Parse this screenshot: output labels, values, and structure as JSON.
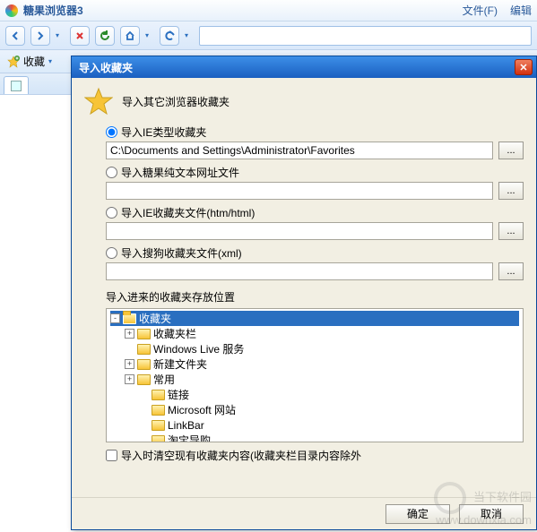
{
  "window": {
    "title": "糖果浏览器3"
  },
  "menu": {
    "file": "文件(F)",
    "edit": "编辑"
  },
  "favbar": {
    "label": "收藏"
  },
  "dialog": {
    "title": "导入收藏夹",
    "intro": "导入其它浏览器收藏夹",
    "opts": {
      "ie": {
        "label": "导入IE类型收藏夹",
        "path": "C:\\Documents and Settings\\Administrator\\Favorites"
      },
      "txt": {
        "label": "导入糖果纯文本网址文件",
        "path": ""
      },
      "htm": {
        "label": "导入IE收藏夹文件(htm/html)",
        "path": ""
      },
      "xml": {
        "label": "导入搜狗收藏夹文件(xml)",
        "path": ""
      }
    },
    "browse": "...",
    "dest_label": "导入进来的收藏夹存放位置",
    "tree": [
      {
        "label": "收藏夹",
        "depth": 0,
        "exp": "-",
        "sel": true
      },
      {
        "label": "收藏夹栏",
        "depth": 1,
        "exp": "+"
      },
      {
        "label": "Windows Live 服务",
        "depth": 1,
        "exp": ""
      },
      {
        "label": "新建文件夹",
        "depth": 1,
        "exp": "+"
      },
      {
        "label": "常用",
        "depth": 1,
        "exp": "+"
      },
      {
        "label": "链接",
        "depth": 2,
        "exp": ""
      },
      {
        "label": "Microsoft 网站",
        "depth": 2,
        "exp": ""
      },
      {
        "label": "LinkBar",
        "depth": 2,
        "exp": ""
      },
      {
        "label": "淘宝导购",
        "depth": 2,
        "exp": ""
      }
    ],
    "clear_checkbox": "导入时清空现有收藏夹内容(收藏夹栏目录内容除外",
    "ok": "确定",
    "cancel": "取消"
  },
  "watermark": {
    "line1": "当下软件园",
    "line2": "www.downxia.com"
  }
}
